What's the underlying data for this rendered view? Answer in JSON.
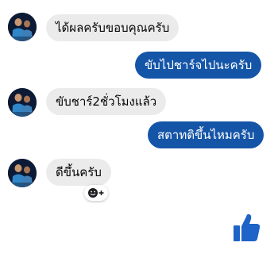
{
  "conversation": {
    "messages": [
      {
        "direction": "incoming",
        "text": "ได้ผลครับขอบคุณครับ"
      },
      {
        "direction": "outgoing",
        "text": "ขับไปชาร์จไปนะครับ"
      },
      {
        "direction": "incoming",
        "text": "ขับชาร์2ชั่วโมงแล้ว"
      },
      {
        "direction": "outgoing",
        "text": "สตาทติขึ้นไหมครับ"
      },
      {
        "direction": "incoming",
        "text": "ดีขึ้นครับ"
      }
    ]
  },
  "icons": {
    "contact_avatar": "avatar-photo",
    "reaction": "add-reaction-icon",
    "like": "thumbs-up-icon"
  },
  "colors": {
    "incoming_bubble": "#ebebeb",
    "outgoing_bubble": "#1455a8",
    "accent": "#1e63c7"
  }
}
